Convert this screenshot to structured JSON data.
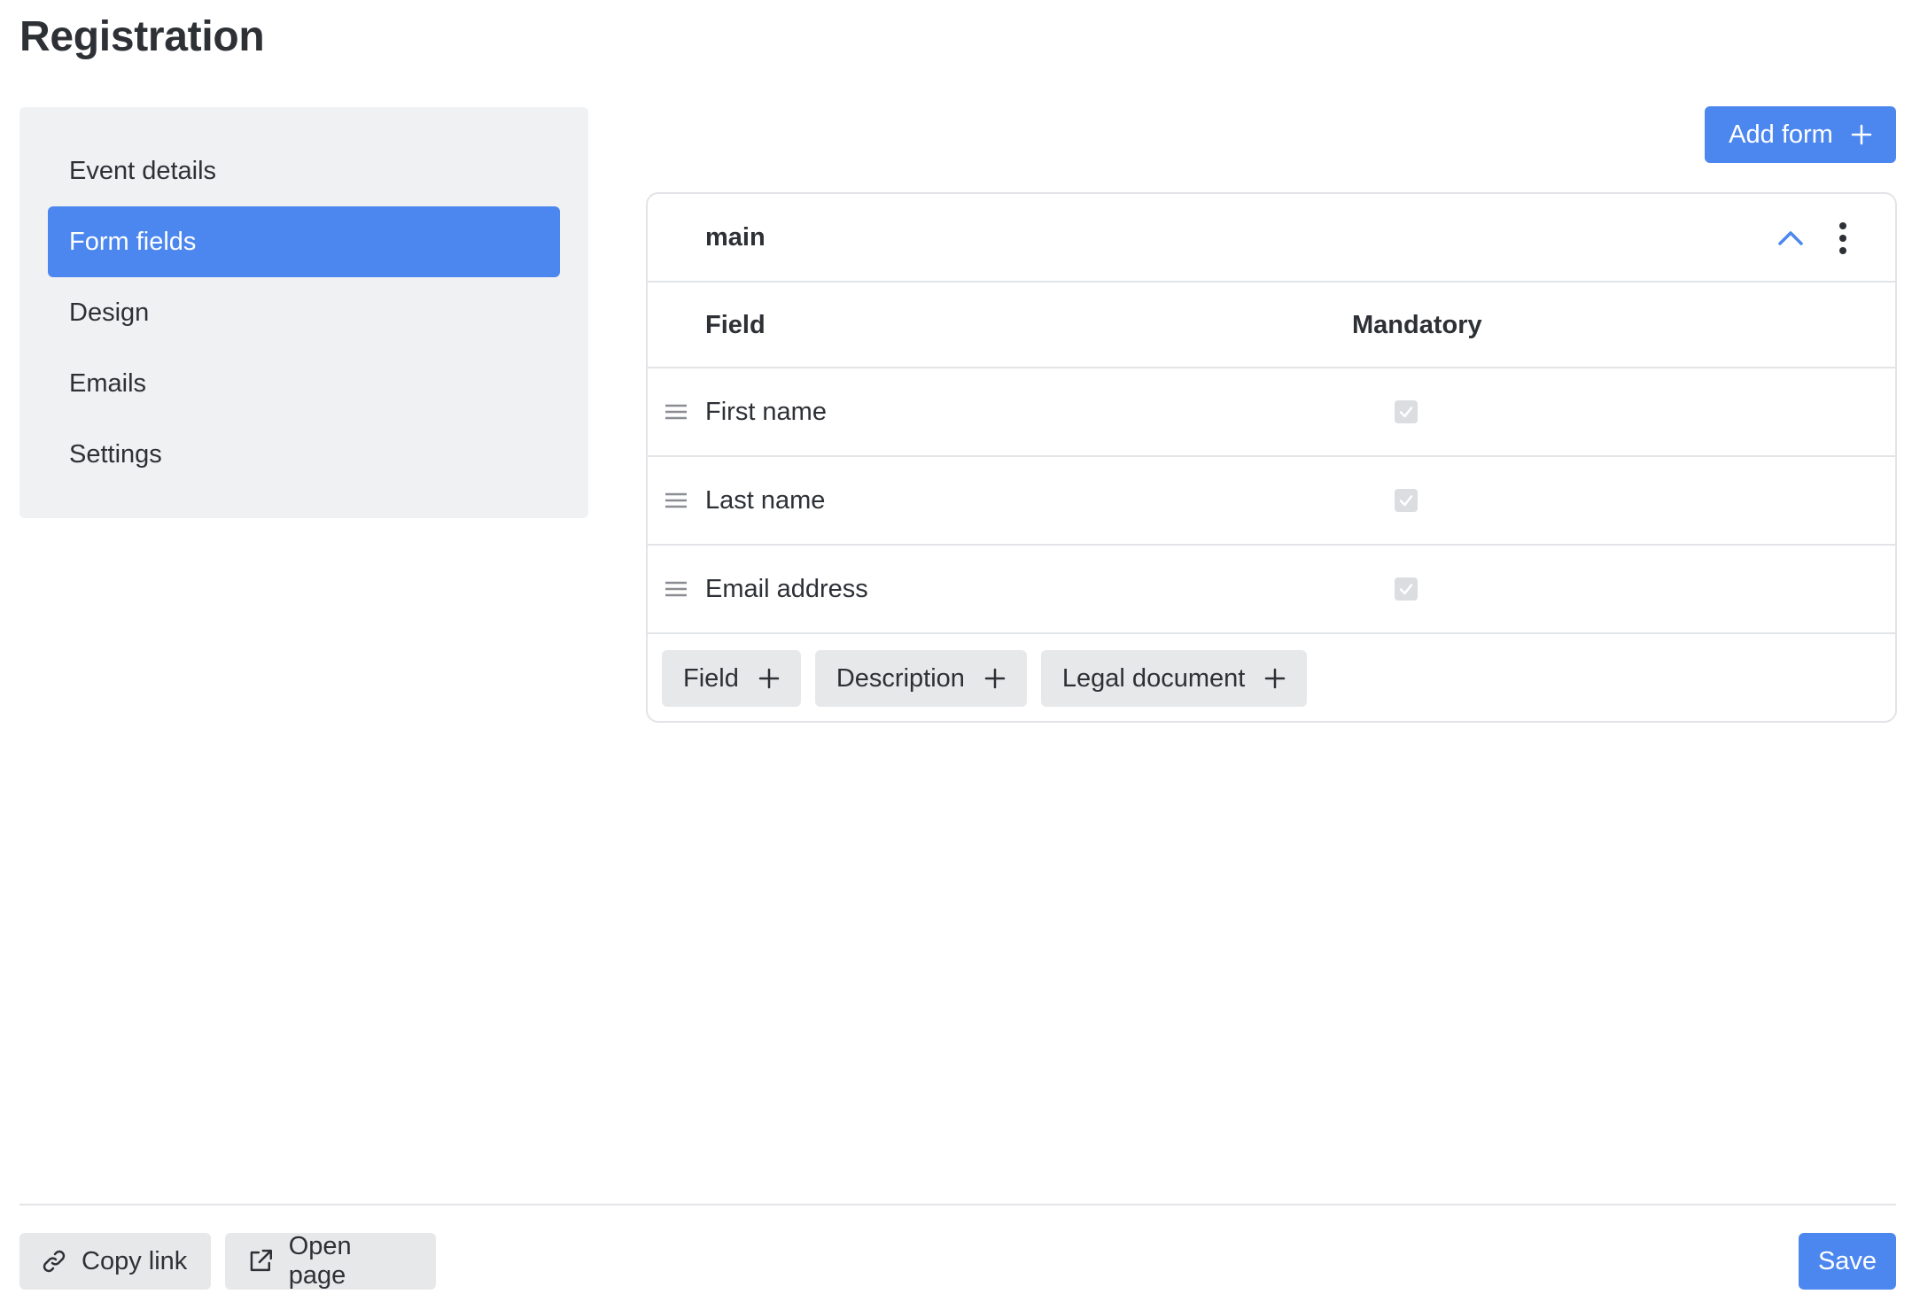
{
  "page": {
    "title": "Registration"
  },
  "sidebar": {
    "items": [
      {
        "label": "Event details",
        "active": false
      },
      {
        "label": "Form fields",
        "active": true
      },
      {
        "label": "Design",
        "active": false
      },
      {
        "label": "Emails",
        "active": false
      },
      {
        "label": "Settings",
        "active": false
      }
    ]
  },
  "toolbar": {
    "add_form_label": "Add form",
    "add_form_icon": "plus-icon"
  },
  "form": {
    "name": "main",
    "collapse_icon": "chevron-up-icon",
    "menu_icon": "kebab-menu-icon",
    "columns": {
      "field": "Field",
      "mandatory": "Mandatory"
    },
    "rows": [
      {
        "label": "First name",
        "mandatory": true
      },
      {
        "label": "Last name",
        "mandatory": true
      },
      {
        "label": "Email address",
        "mandatory": true
      }
    ],
    "add_buttons": [
      {
        "label": "Field",
        "icon": "plus-icon"
      },
      {
        "label": "Description",
        "icon": "plus-icon"
      },
      {
        "label": "Legal document",
        "icon": "plus-icon"
      }
    ]
  },
  "footer": {
    "copy_link_label": "Copy link",
    "copy_link_icon": "link-icon",
    "open_page_label": "Open page",
    "open_page_icon": "external-link-icon",
    "save_label": "Save"
  },
  "colors": {
    "accent": "#4c87ef",
    "sidebar_bg": "#f0f1f3",
    "button_gray": "#e7e8ea",
    "border": "#e2e4e8",
    "text": "#2d3035"
  }
}
